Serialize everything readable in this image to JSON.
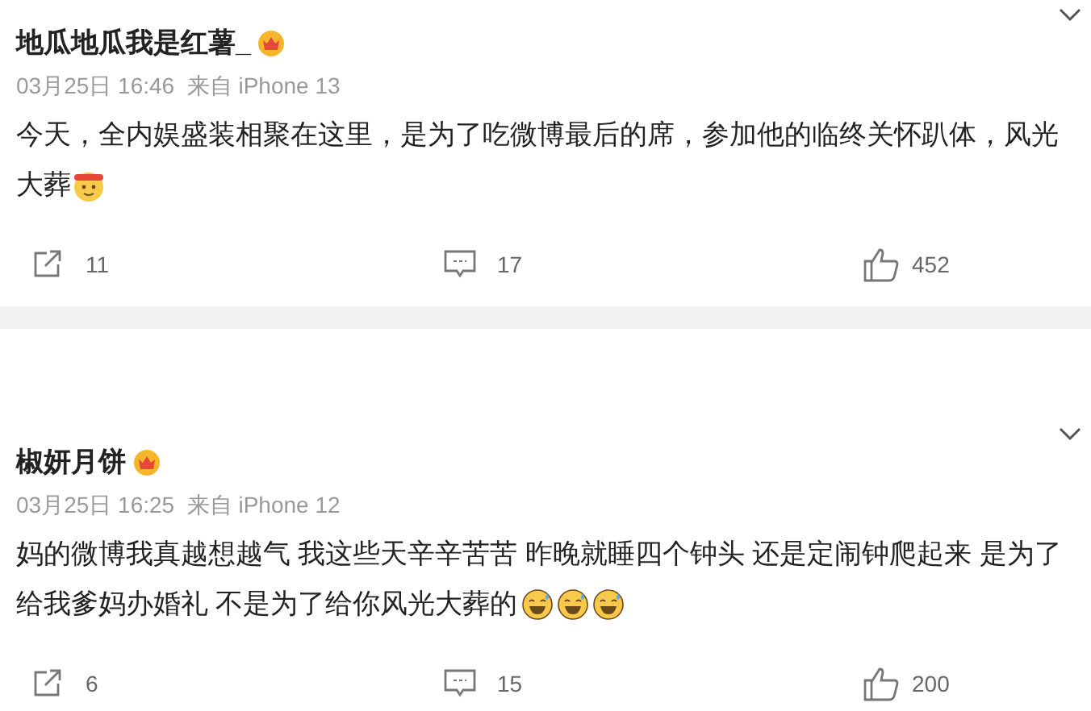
{
  "posts": [
    {
      "username": "地瓜地瓜我是红薯_",
      "meta": "03月25日 16:46  来自 iPhone 13",
      "text_lines": [
        "今天，全内娱盛装相聚在这里，是为了吃微博最后的席，参加他的临终关怀趴体，风光",
        "大葬"
      ],
      "emojis": [
        {
          "kind": "bandana"
        }
      ],
      "reposts": "11",
      "comments": "17",
      "likes": "452"
    },
    {
      "username": "椒妍月饼",
      "meta": "03月25日 16:25  来自 iPhone 12",
      "text_lines": [
        "妈的微博我真越想越气 我这些天辛辛苦苦 昨晚就睡四个钟头 还是定闹钟爬起来 是为了",
        "给我爹妈办婚礼 不是为了给你风光大葬的"
      ],
      "emojis": [
        {
          "kind": "sweat"
        },
        {
          "kind": "sweat"
        },
        {
          "kind": "sweat"
        }
      ],
      "reposts": "6",
      "comments": "15",
      "likes": "200"
    }
  ]
}
